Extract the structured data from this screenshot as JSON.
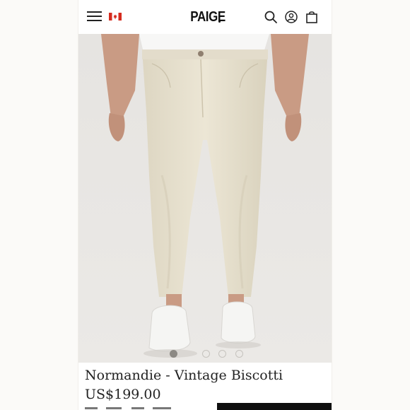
{
  "header": {
    "brand": "PAIGE",
    "menu_icon": "hamburger-menu-icon",
    "flag_icon": "canada-flag-icon",
    "search_icon": "search-icon",
    "account_icon": "account-icon",
    "bag_icon": "shopping-bag-icon"
  },
  "gallery": {
    "image_subject": "model wearing off-white straight-leg jeans and white sneakers",
    "slide_count": 4,
    "active_slide": 1
  },
  "product": {
    "name": "Normandie - Vintage Biscotti",
    "price": "US$199.00"
  },
  "colors": {
    "accent": "#0f0f0f",
    "background": "#ffffff",
    "denim": "#e9e3d1"
  }
}
